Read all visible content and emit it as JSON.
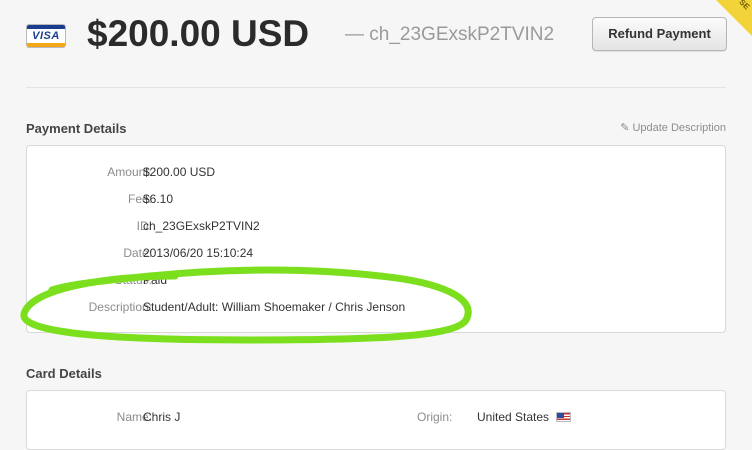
{
  "header": {
    "card_brand": "VISA",
    "amount_title": "$200.00 USD",
    "charge_id_display": "— ch_23GExskP2TVIN2",
    "refund_button": "Refund Payment",
    "corner_badge": "SE"
  },
  "payment_details": {
    "title": "Payment Details",
    "update_link": "Update Description",
    "rows": [
      {
        "label": "Amount:",
        "value": "$200.00 USD"
      },
      {
        "label": "Fee:",
        "value": "$6.10"
      },
      {
        "label": "ID:",
        "value": "ch_23GExskP2TVIN2"
      },
      {
        "label": "Date:",
        "value": "2013/06/20 15:10:24"
      },
      {
        "label": "Status:",
        "value": "Paid"
      },
      {
        "label": "Description:",
        "value": "Student/Adult: William Shoemaker / Chris Jenson"
      }
    ]
  },
  "card_details": {
    "title": "Card Details",
    "name_label": "Name:",
    "name_value": "Chris J",
    "origin_label": "Origin:",
    "origin_value": "United States"
  },
  "annotation_color": "#7cdf1e",
  "icons": {
    "pencil": "pencil-icon",
    "flag": "us-flag-icon",
    "card": "visa-card-icon"
  }
}
